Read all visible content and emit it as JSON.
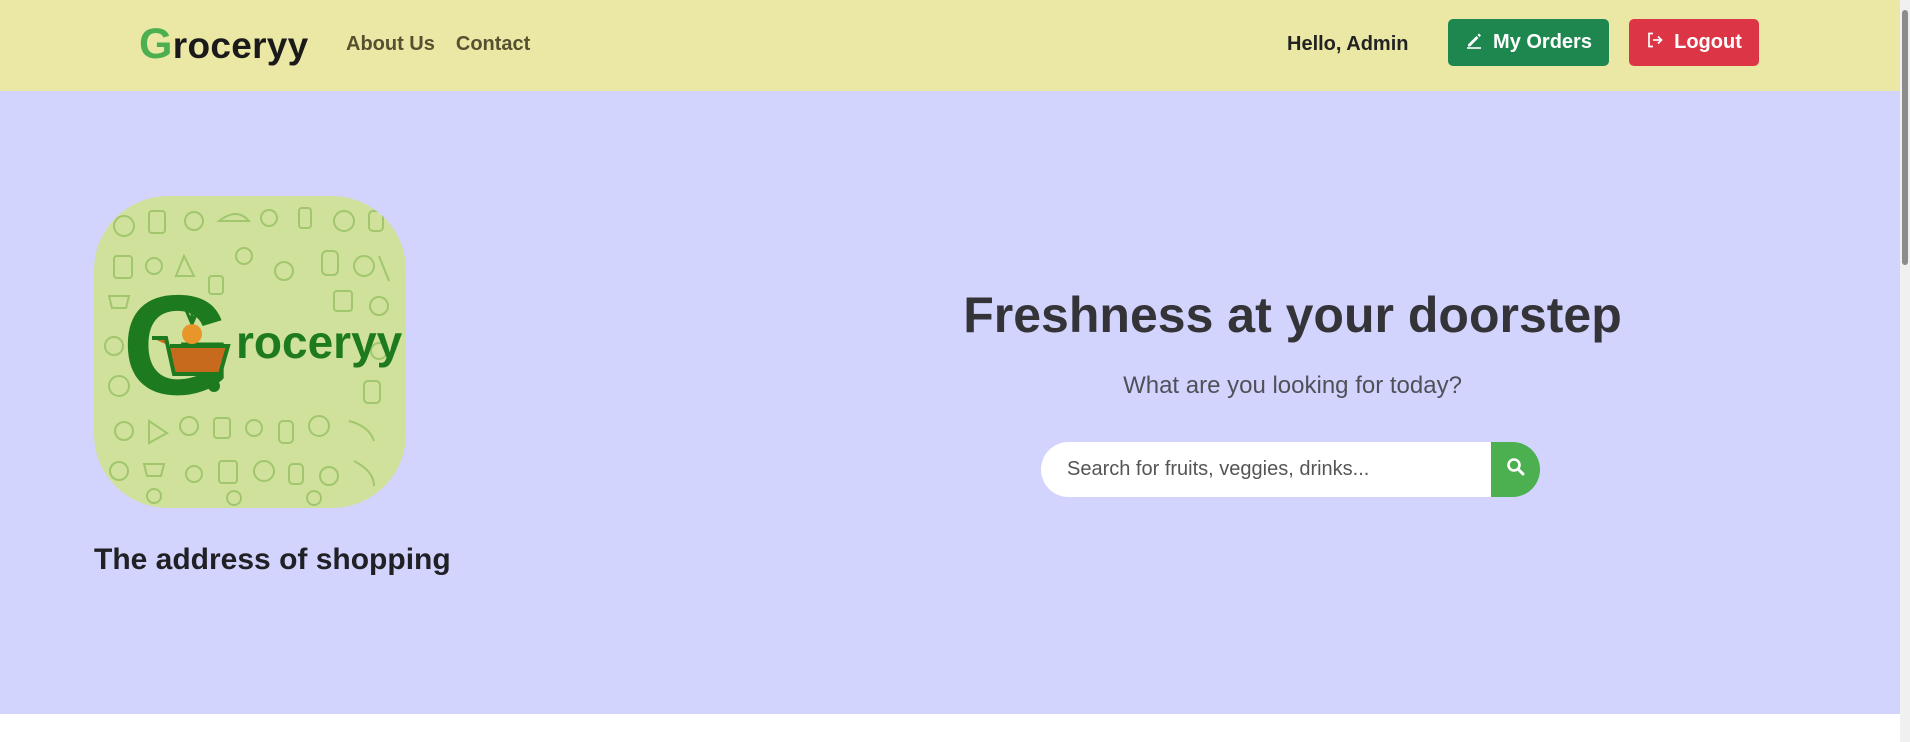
{
  "navbar": {
    "brand_first": "G",
    "brand_rest": "roceryy",
    "links": [
      {
        "label": "About Us"
      },
      {
        "label": "Contact"
      }
    ],
    "greeting": "Hello, Admin",
    "orders_button": {
      "label": "My Orders",
      "icon": "pencil-icon",
      "color": "#1e8750"
    },
    "logout_button": {
      "label": "Logout",
      "icon": "logout-icon",
      "color": "#dc3545"
    },
    "background": "#ebe8a5"
  },
  "hero": {
    "background": "#d2d4fe",
    "logo": {
      "letter": "G",
      "word": "roceryy",
      "tile_color": "#cfe19a",
      "logo_green": "#1e7a1e"
    },
    "tagline": "The address of shopping",
    "title": "Freshness at your doorstep",
    "subtitle": "What are you looking for today?",
    "search": {
      "placeholder": "Search for fruits, veggies, drinks...",
      "value": "",
      "button_icon": "search-icon",
      "button_color": "#4caf50"
    }
  }
}
